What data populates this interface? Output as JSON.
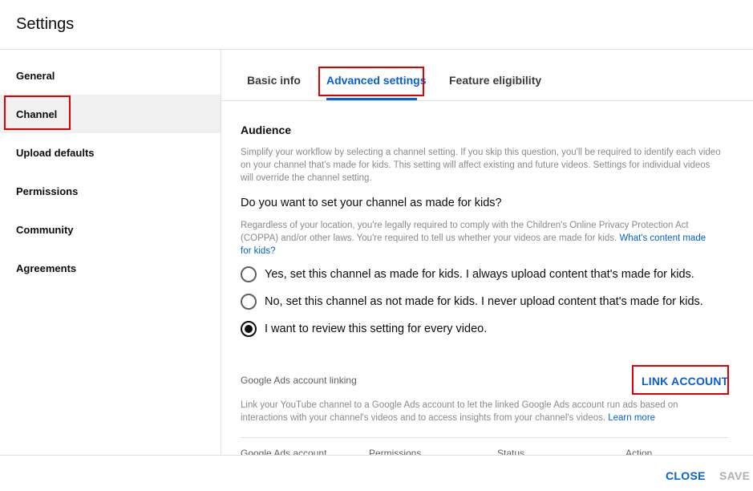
{
  "dialog": {
    "title": "Settings"
  },
  "sidebar": {
    "items": [
      {
        "label": "General"
      },
      {
        "label": "Channel"
      },
      {
        "label": "Upload defaults"
      },
      {
        "label": "Permissions"
      },
      {
        "label": "Community"
      },
      {
        "label": "Agreements"
      }
    ],
    "active": "Channel"
  },
  "tabs": {
    "items": [
      {
        "label": "Basic info"
      },
      {
        "label": "Advanced settings"
      },
      {
        "label": "Feature eligibility"
      }
    ],
    "active": "Advanced settings"
  },
  "audience": {
    "title": "Audience",
    "description": "Simplify your workflow by selecting a channel setting. If you skip this question, you'll be required to identify each video on your channel that's made for kids. This setting will affect existing and future videos. Settings for individual videos will override the channel setting.",
    "question": "Do you want to set your channel as made for kids?",
    "legal_text": "Regardless of your location, you're legally required to comply with the Children's Online Privacy Protection Act (COPPA) and/or other laws. You're required to tell us whether your videos are made for kids.",
    "legal_link": "What's content made for kids?",
    "options": [
      {
        "label": "Yes, set this channel as made for kids. I always upload content that's made for kids.",
        "checked": false
      },
      {
        "label": "No, set this channel as not made for kids. I never upload content that's made for kids.",
        "checked": false
      },
      {
        "label": "I want to review this setting for every video.",
        "checked": true
      }
    ]
  },
  "ads": {
    "title": "Google Ads account linking",
    "link_button": "LINK ACCOUNT",
    "description": "Link your YouTube channel to a Google Ads account to let the linked Google Ads account run ads based on interactions with your channel's videos and to access insights from your channel's videos.",
    "learn_more": "Learn more",
    "table_headers": [
      "Google Ads account",
      "Permissions",
      "Status",
      "Action"
    ]
  },
  "footer": {
    "close_label": "CLOSE",
    "save_label": "SAVE"
  },
  "colors": {
    "accent": "#065fd4",
    "highlight": "#e00000",
    "active_bg": "#f0f0f0"
  }
}
